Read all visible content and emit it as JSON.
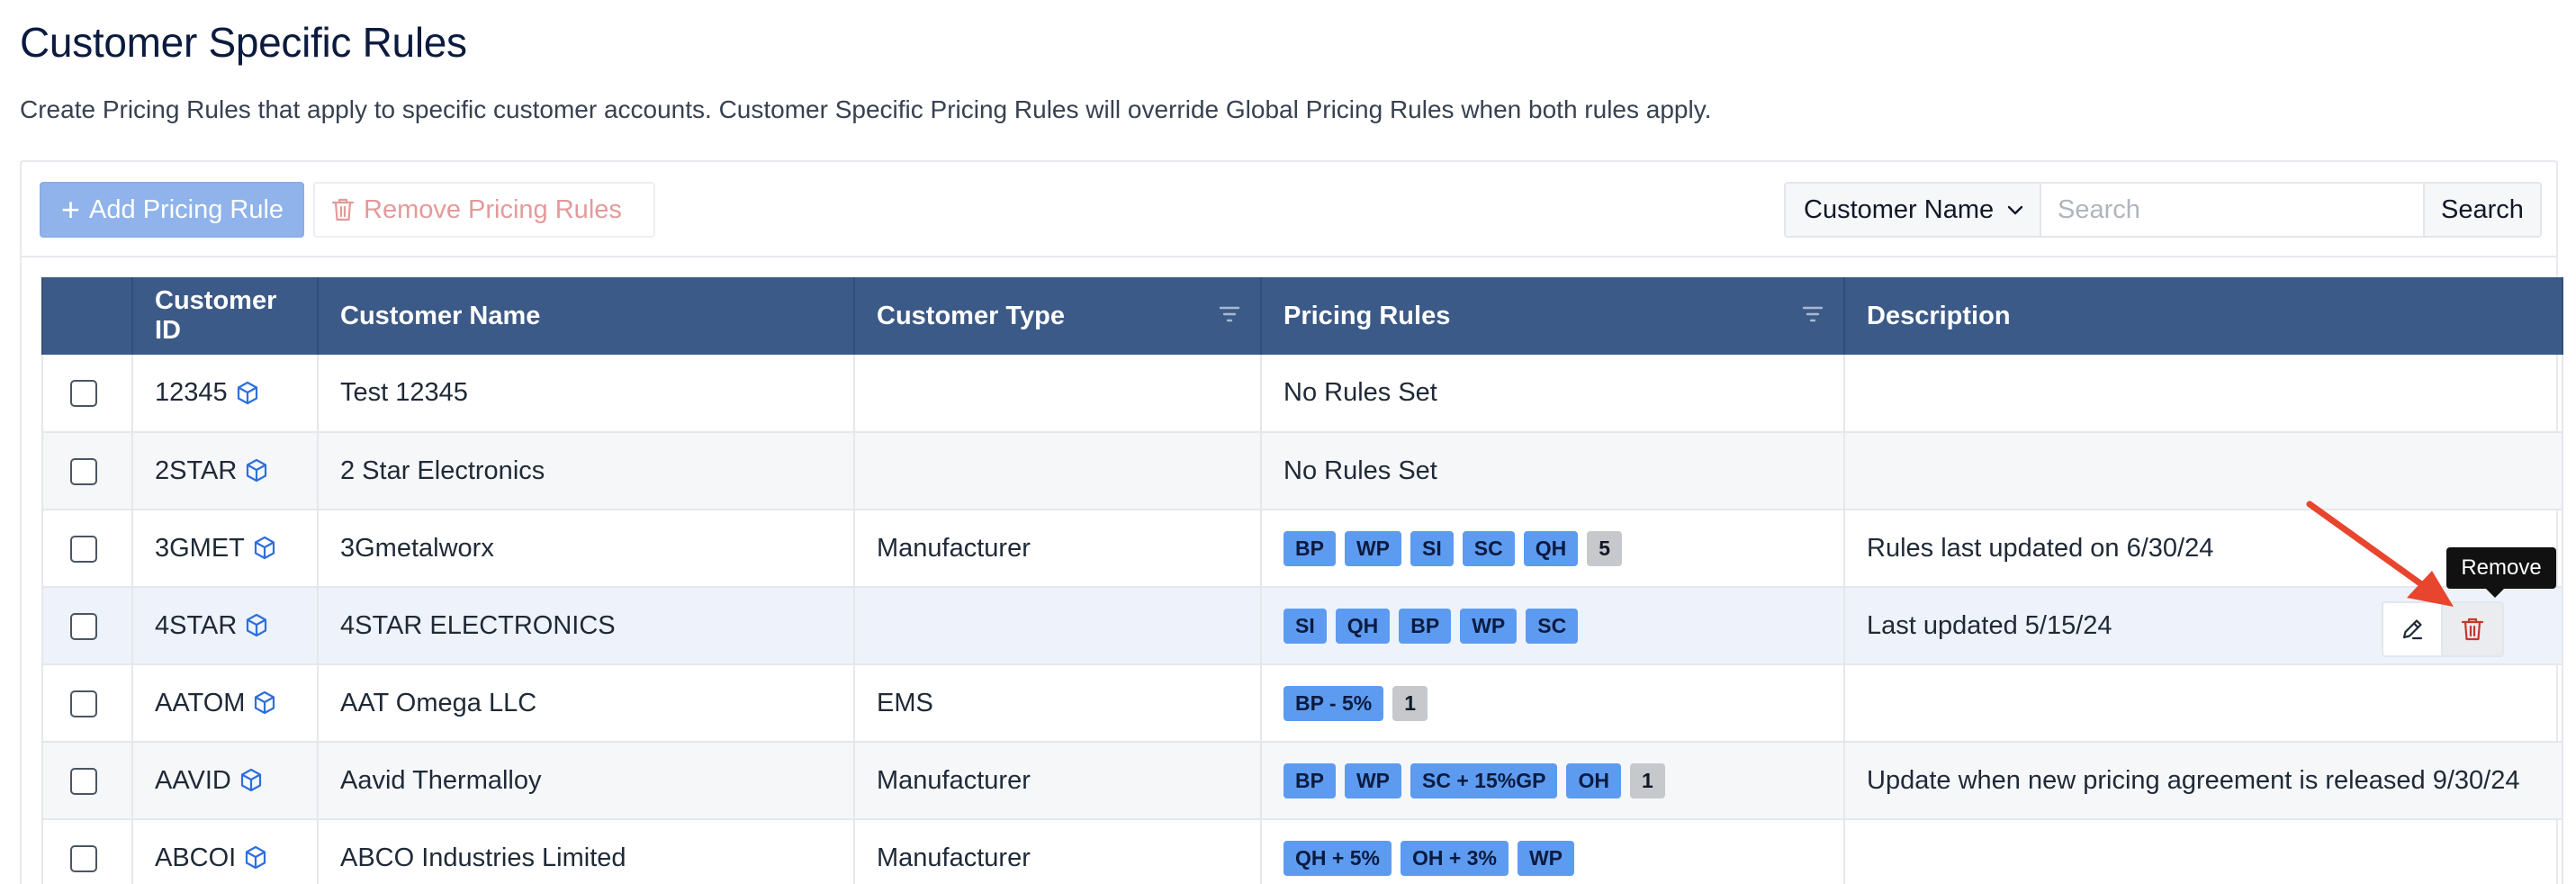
{
  "page": {
    "title": "Customer Specific Rules",
    "description": "Create Pricing Rules that apply to specific customer accounts. Customer Specific Pricing Rules will override Global Pricing Rules when both rules apply."
  },
  "toolbar": {
    "add_label": "Add Pricing Rule",
    "remove_label": "Remove Pricing Rules",
    "filter_field": "Customer Name",
    "search_placeholder": "Search",
    "search_value": "",
    "search_button": "Search"
  },
  "table": {
    "headers": {
      "customer_id": "Customer ID",
      "customer_name": "Customer Name",
      "customer_type": "Customer Type",
      "pricing_rules": "Pricing Rules",
      "description": "Description"
    },
    "rows": [
      {
        "id": "12345",
        "name": "Test 12345",
        "type": "",
        "rules_text": "No Rules Set",
        "tags": [],
        "more": "",
        "description": ""
      },
      {
        "id": "2STAR",
        "name": "2 Star Electronics",
        "type": "",
        "rules_text": "No Rules Set",
        "tags": [],
        "more": "",
        "description": ""
      },
      {
        "id": "3GMET",
        "name": "3Gmetalworx",
        "type": "Manufacturer",
        "rules_text": "",
        "tags": [
          "BP",
          "WP",
          "SI",
          "SC",
          "QH"
        ],
        "more": "5",
        "description": "Rules last updated on 6/30/24"
      },
      {
        "id": "4STAR",
        "name": "4STAR ELECTRONICS",
        "type": "",
        "rules_text": "",
        "tags": [
          "SI",
          "QH",
          "BP",
          "WP",
          "SC"
        ],
        "more": "",
        "description": "Last updated 5/15/24"
      },
      {
        "id": "AATOM",
        "name": "AAT Omega LLC",
        "type": "EMS",
        "rules_text": "",
        "tags": [
          "BP - 5%"
        ],
        "more": "1",
        "description": ""
      },
      {
        "id": "AAVID",
        "name": "Aavid Thermalloy",
        "type": "Manufacturer",
        "rules_text": "",
        "tags": [
          "BP",
          "WP",
          "SC + 15%GP",
          "OH"
        ],
        "more": "1",
        "description": "Update when new pricing agreement is released 9/30/24"
      },
      {
        "id": "ABCOI",
        "name": "ABCO Industries Limited",
        "type": "Manufacturer",
        "rules_text": "",
        "tags": [
          "QH + 5%",
          "OH + 3%",
          "WP"
        ],
        "more": "",
        "description": ""
      }
    ]
  },
  "tooltip": {
    "text": "Remove"
  },
  "colors": {
    "header_bg": "#3b5a87",
    "tag_bg": "#5d9bf0",
    "more_tag_bg": "#c6c8cc",
    "add_button_bg": "#8fb3ea",
    "remove_text": "#e49a9a",
    "delete_icon": "#c0392b",
    "arrow": "#e8452f"
  },
  "icons": {
    "customer_id_icon": "cube-icon",
    "add": "plus-icon",
    "remove": "trash-icon",
    "column_filter": "filter-lines-icon",
    "edit": "pencil-icon",
    "delete": "trash-icon",
    "select_chevron": "chevron-down-icon"
  }
}
